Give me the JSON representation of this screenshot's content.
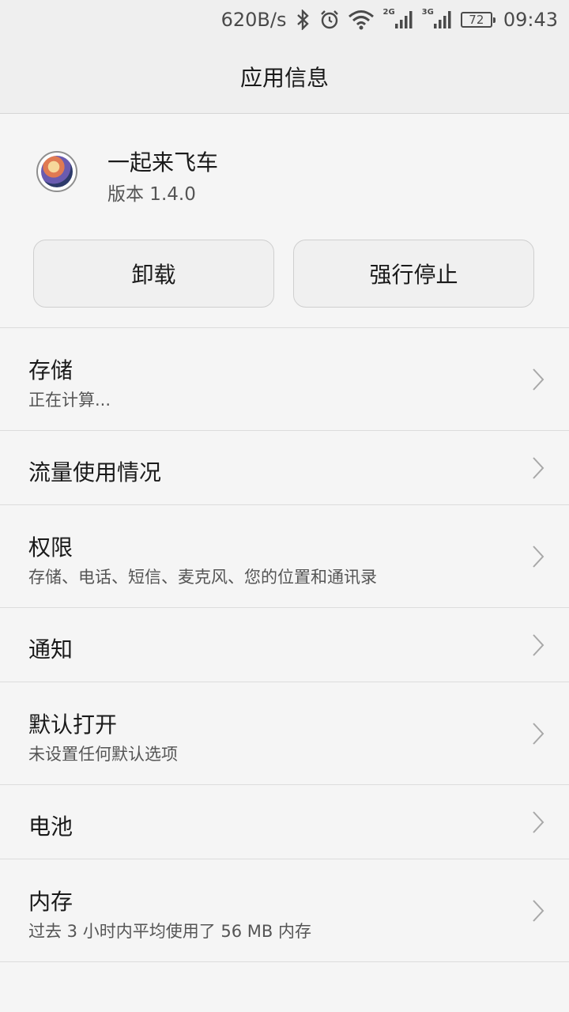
{
  "status_bar": {
    "net_speed": "620B/s",
    "bluetooth_icon": "bluetooth-icon",
    "alarm_icon": "alarm-icon",
    "wifi_icon": "wifi-icon",
    "signal1_label": "2G",
    "signal2_label": "3G",
    "battery_level": "72",
    "time": "09:43"
  },
  "header": {
    "title": "应用信息"
  },
  "app": {
    "name": "一起来飞车",
    "version": "版本 1.4.0",
    "icon": "app-icon"
  },
  "buttons": {
    "uninstall": "卸载",
    "force_stop": "强行停止"
  },
  "items": [
    {
      "title": "存储",
      "subtitle": "正在计算..."
    },
    {
      "title": "流量使用情况",
      "subtitle": ""
    },
    {
      "title": "权限",
      "subtitle": "存储、电话、短信、麦克风、您的位置和通讯录"
    },
    {
      "title": "通知",
      "subtitle": ""
    },
    {
      "title": "默认打开",
      "subtitle": "未设置任何默认选项"
    },
    {
      "title": "电池",
      "subtitle": ""
    },
    {
      "title": "内存",
      "subtitle": "过去 3 小时内平均使用了 56 MB 内存"
    }
  ]
}
